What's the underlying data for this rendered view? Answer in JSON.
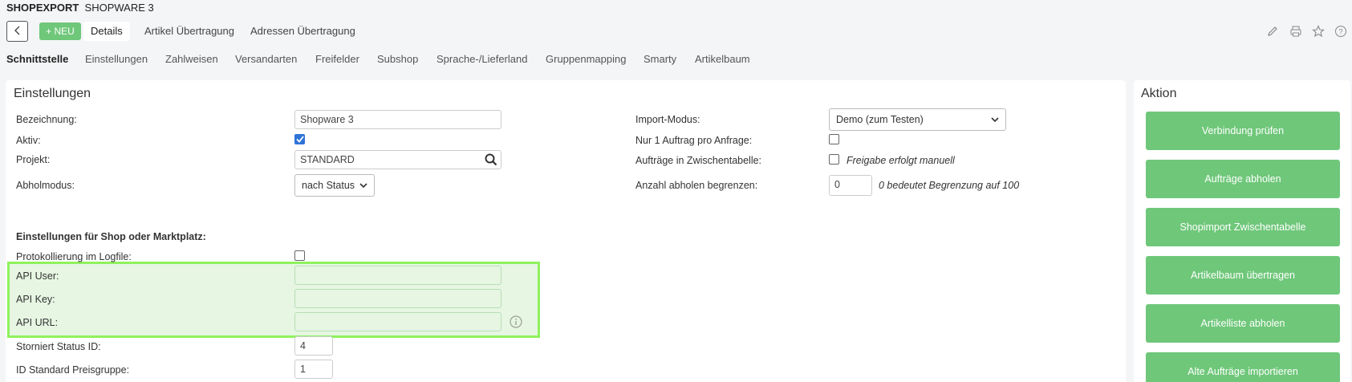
{
  "header": {
    "module": "SHOPEXPORT",
    "name": "SHOPWARE 3",
    "new_label": "+ NEU"
  },
  "main_tabs": [
    "Details",
    "Artikel Übertragung",
    "Adressen Übertragung"
  ],
  "toolbar_icons": [
    "edit-icon",
    "print-icon",
    "star-icon",
    "help-icon"
  ],
  "sub_tabs": [
    "Schnittstelle",
    "Einstellungen",
    "Zahlweisen",
    "Versandarten",
    "Freifelder",
    "Subshop",
    "Sprache-/Lieferland",
    "Gruppenmapping",
    "Smarty",
    "Artikelbaum"
  ],
  "settings": {
    "title": "Einstellungen",
    "bezeichnung": {
      "label": "Bezeichnung:",
      "value": "Shopware 3"
    },
    "aktiv": {
      "label": "Aktiv:",
      "checked": true
    },
    "projekt": {
      "label": "Projekt:",
      "value": "STANDARD"
    },
    "abholmodus": {
      "label": "Abholmodus:",
      "value": "nach Status"
    },
    "import_modus": {
      "label": "Import-Modus:",
      "value": "Demo (zum Testen)"
    },
    "nur1": {
      "label": "Nur 1 Auftrag pro Anfrage:",
      "checked": false
    },
    "zwischentabelle": {
      "label": "Aufträge in Zwischentabelle:",
      "checked": false,
      "hint": "Freigabe erfolgt manuell"
    },
    "anzahl": {
      "label": "Anzahl abholen begrenzen:",
      "value": "0",
      "hint": "0 bedeutet Begrenzung auf 100"
    },
    "section_title": "Einstellungen für Shop oder Marktplatz:",
    "protokoll": {
      "label": "Protokollierung im Logfile:",
      "checked": false
    },
    "api_user": {
      "label": "API User:",
      "value": ""
    },
    "api_key": {
      "label": "API Key:",
      "value": ""
    },
    "api_url": {
      "label": "API URL:",
      "value": ""
    },
    "storniert": {
      "label": "Storniert Status ID:",
      "value": "4"
    },
    "preisgruppe": {
      "label": "ID Standard Preisgruppe:",
      "value": "1"
    }
  },
  "aktion": {
    "title": "Aktion",
    "buttons": [
      "Verbindung prüfen",
      "Aufträge abholen",
      "Shopimport Zwischentabelle",
      "Artikelbaum übertragen",
      "Artikelliste abholen",
      "Alte Aufträge importieren"
    ]
  },
  "colors": {
    "accent_green": "#6fc77a",
    "highlight_border": "#8ff25e",
    "checkbox_blue": "#2f74d6"
  }
}
